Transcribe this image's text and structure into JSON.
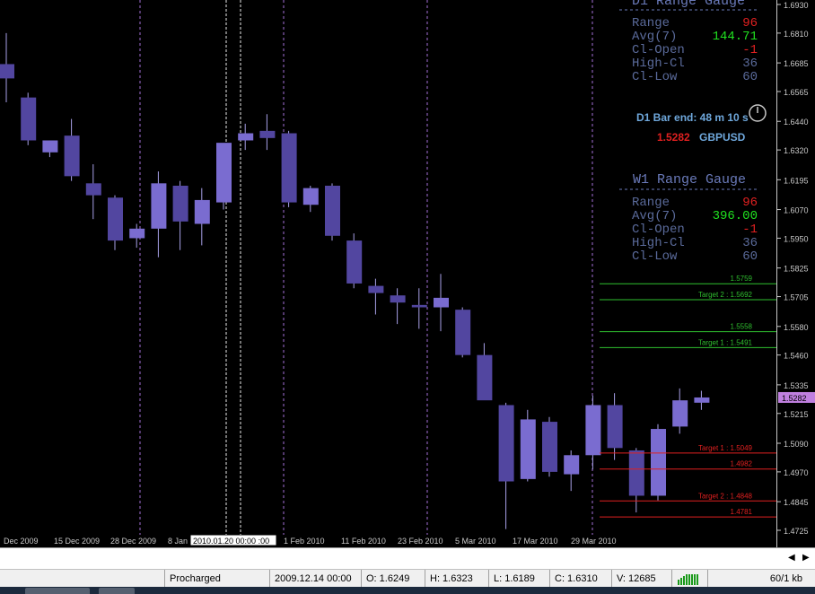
{
  "colors": {
    "bull_candle": "#7a6cd0",
    "bear_candle": "#5246a0",
    "wick": "#a8a0e8",
    "gauge_label": "#5a6a9a",
    "gauge_red": "#e02020",
    "gauge_green": "#20e020",
    "gauge_title": "#6a7aba",
    "bar_end": "#6fa8dc",
    "price_red": "#e02020",
    "target_green": "#2fbf2f",
    "target_red": "#e02020",
    "period_sep": "#a56fd8",
    "current_price_box": "#c080e0"
  },
  "price_axis": {
    "labels": [
      "1.6930",
      "1.6810",
      "1.6685",
      "1.6565",
      "1.6440",
      "1.6320",
      "1.6195",
      "1.6070",
      "1.5950",
      "1.5825",
      "1.5705",
      "1.5580",
      "1.5460",
      "1.5335",
      "1.5215",
      "1.5090",
      "1.4970",
      "1.4845",
      "1.4725"
    ],
    "current_price": "1.5282"
  },
  "time_axis": {
    "labels": [
      "Dec 2009",
      "15 Dec 2009",
      "28 Dec 2009",
      "8 Jan",
      "1 Feb 2010",
      "11 Feb 2010",
      "23 Feb 2010",
      "5 Mar 2010",
      "17 Mar 2010",
      "29 Mar 2010"
    ],
    "crosshair_label": "2010.01.20 00:00 :00"
  },
  "d1_gauge": {
    "title": "D1 Range Gauge",
    "rows": [
      {
        "label": "Range",
        "value": "96",
        "color": "red"
      },
      {
        "label": " Avg(7)",
        "value": "144.71",
        "color": "green"
      },
      {
        "label": "Cl-Open",
        "value": "-1",
        "color": "red"
      },
      {
        "label": "High-Cl",
        "value": "36",
        "color": "label"
      },
      {
        "label": "Cl-Low",
        "value": "60",
        "color": "label"
      }
    ]
  },
  "bar_end": {
    "text": "D1 Bar end: 48 m 10 s",
    "price": "1.5282",
    "symbol": "GBPUSD"
  },
  "w1_gauge": {
    "title": "W1 Range Gauge",
    "rows": [
      {
        "label": "Range",
        "value": "96",
        "color": "red"
      },
      {
        "label": " Avg(7)",
        "value": "396.00",
        "color": "green"
      },
      {
        "label": "Cl-Open",
        "value": "-1",
        "color": "red"
      },
      {
        "label": "High-Cl",
        "value": "36",
        "color": "label"
      },
      {
        "label": "Cl-Low",
        "value": "60",
        "color": "label"
      }
    ]
  },
  "targets": [
    {
      "label": "1.5759",
      "price": 1.5759,
      "color": "green"
    },
    {
      "label": "Target 2 : 1.5692",
      "price": 1.5692,
      "color": "green"
    },
    {
      "label": "1.5558",
      "price": 1.5558,
      "color": "green"
    },
    {
      "label": "Target 1 : 1.5491",
      "price": 1.5491,
      "color": "green"
    },
    {
      "label": "Target 1 : 1.5049",
      "price": 1.5049,
      "color": "red"
    },
    {
      "label": "1.4982",
      "price": 1.4982,
      "color": "red"
    },
    {
      "label": "Target 2 : 1.4848",
      "price": 1.4848,
      "color": "red"
    },
    {
      "label": "1.4781",
      "price": 1.4781,
      "color": "red"
    }
  ],
  "chart_data": {
    "type": "candlestick",
    "symbol": "GBPUSD",
    "timeframe": "D1",
    "ylim": [
      1.4725,
      1.699
    ],
    "ohlc": [
      [
        1.668,
        1.681,
        1.652,
        1.662
      ],
      [
        1.654,
        1.656,
        1.634,
        1.636
      ],
      [
        1.631,
        1.636,
        1.629,
        1.636
      ],
      [
        1.638,
        1.645,
        1.619,
        1.621
      ],
      [
        1.618,
        1.626,
        1.603,
        1.613
      ],
      [
        1.612,
        1.613,
        1.59,
        1.594
      ],
      [
        1.595,
        1.601,
        1.591,
        1.599
      ],
      [
        1.599,
        1.623,
        1.587,
        1.618
      ],
      [
        1.617,
        1.619,
        1.59,
        1.602
      ],
      [
        1.601,
        1.616,
        1.592,
        1.611
      ],
      [
        1.61,
        1.627,
        1.607,
        1.635
      ],
      [
        1.636,
        1.643,
        1.632,
        1.639
      ],
      [
        1.64,
        1.647,
        1.632,
        1.637
      ],
      [
        1.639,
        1.64,
        1.608,
        1.61
      ],
      [
        1.609,
        1.617,
        1.606,
        1.616
      ],
      [
        1.617,
        1.618,
        1.594,
        1.596
      ],
      [
        1.594,
        1.597,
        1.574,
        1.576
      ],
      [
        1.575,
        1.578,
        1.563,
        1.572
      ],
      [
        1.571,
        1.574,
        1.559,
        1.568
      ],
      [
        1.567,
        1.574,
        1.557,
        1.566
      ],
      [
        1.566,
        1.58,
        1.556,
        1.57
      ],
      [
        1.565,
        1.566,
        1.545,
        1.546
      ],
      [
        1.546,
        1.551,
        1.53,
        1.527
      ],
      [
        1.525,
        1.526,
        1.473,
        1.493
      ],
      [
        1.494,
        1.523,
        1.493,
        1.519
      ],
      [
        1.518,
        1.52,
        1.495,
        1.497
      ],
      [
        1.496,
        1.506,
        1.489,
        1.504
      ],
      [
        1.504,
        1.529,
        1.498,
        1.525
      ],
      [
        1.525,
        1.53,
        1.502,
        1.507
      ],
      [
        1.506,
        1.507,
        1.48,
        1.487
      ],
      [
        1.487,
        1.517,
        1.485,
        1.515
      ],
      [
        1.516,
        1.532,
        1.513,
        1.527
      ],
      [
        1.526,
        1.531,
        1.523,
        1.5282
      ]
    ]
  },
  "status_bar": {
    "profile": "Procharged",
    "time": "2009.12.14 00:00",
    "open": "O: 1.6249",
    "high": "H: 1.6323",
    "low": "L: 1.6189",
    "close": "C: 1.6310",
    "volume": "V: 12685",
    "traffic": "60/1 kb"
  }
}
